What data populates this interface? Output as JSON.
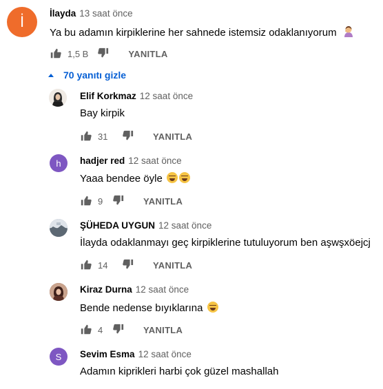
{
  "thread": {
    "top_comment": {
      "author": "İlayda",
      "time": "13 saat önce",
      "avatar_letter": "İ",
      "avatar_color": "#ef6c2b",
      "text": "Ya bu adamın kirpiklerine her sahnede istemsiz odaklanıyorum",
      "emoji": "woman-facepalming",
      "likes": "1,5 B",
      "reply_label": "YANITLA"
    },
    "hide_replies_label": "70 yanıtı gizle",
    "replies": [
      {
        "author": "Elif Korkmaz",
        "time": "12 saat önce",
        "text": "Bay kirpik",
        "likes": "31",
        "reply_label": "YANITLA",
        "avatar_type": "photo",
        "avatar_color": "#2b2b2b"
      },
      {
        "author": "hadjer red",
        "time": "12 saat önce",
        "text": "Yaaa bendee öyle",
        "emoji": "grinning-squinting x2",
        "likes": "9",
        "reply_label": "YANITLA",
        "avatar_letter": "h",
        "avatar_color": "#7e57c2"
      },
      {
        "author": "ŞÜHEDA UYGUN",
        "time": "12 saat önce",
        "text": "İlayda odaklanmayı geç kirpiklerine tutuluyorum ben aşwşxöejcj",
        "likes": "14",
        "reply_label": "YANITLA",
        "avatar_type": "photo",
        "avatar_color": "#8e9aa6"
      },
      {
        "author": "Kiraz Durna",
        "time": "12 saat önce",
        "text": "Bende nedense bıyıklarına",
        "emoji": "grinning-squinting",
        "likes": "4",
        "reply_label": "YANITLA",
        "avatar_type": "photo",
        "avatar_color": "#7a4b3a"
      },
      {
        "author": "Sevim Esma",
        "time": "12 saat önce",
        "text": "Adamın kiprikleri harbi çok güzel mashallah",
        "avatar_letter": "S",
        "avatar_color": "#7e57c2"
      }
    ]
  }
}
